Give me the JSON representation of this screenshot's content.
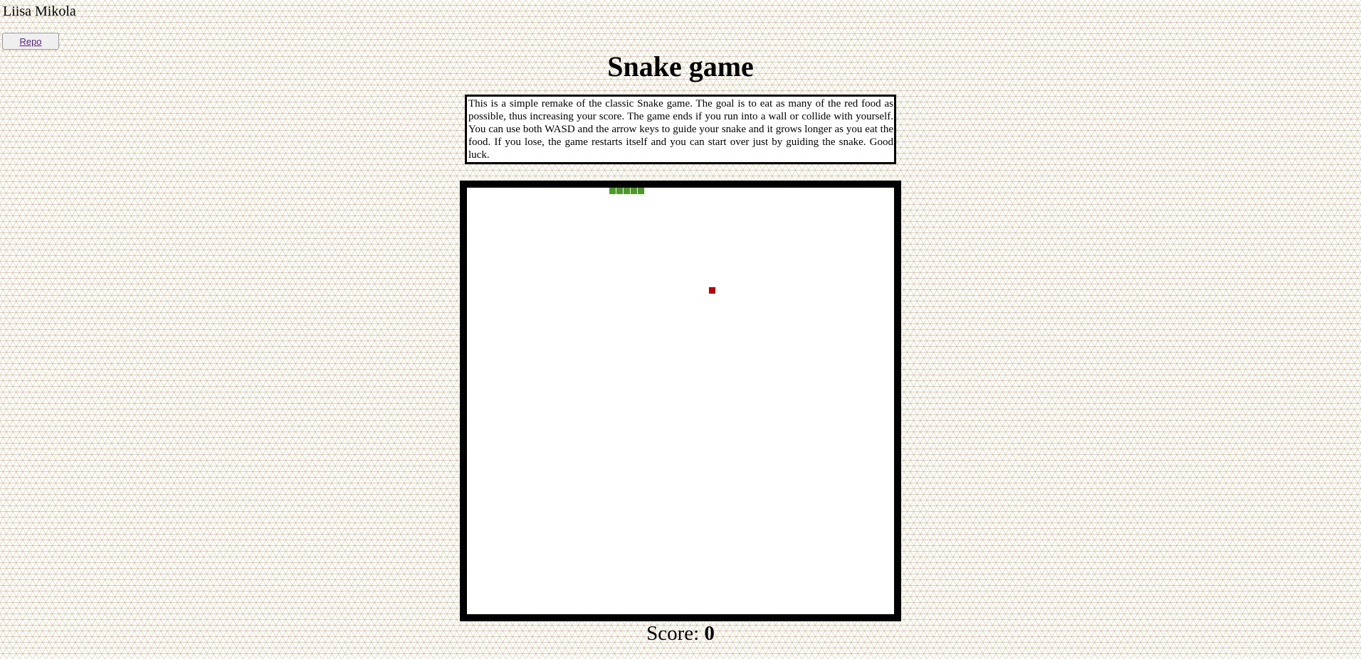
{
  "header": {
    "author": "Liisa Mikola",
    "repo_button_label": "Repo"
  },
  "game": {
    "title": "Snake game",
    "description": "This is a simple remake of the classic Snake game. The goal is to eat as many of the red food as possible, thus increasing your score. The game ends if you run into a wall or collide with yourself. You can use both WASD and the arrow keys to guide your snake and it grows longer as you eat the food. If you lose, the game restarts itself and you can start over just by guiding the snake. Good luck.",
    "score_label": "Score:",
    "score_value": "0"
  },
  "board": {
    "grid_columns": 60,
    "grid_rows": 60,
    "snake_color": "#4a9a2a",
    "food_color": "#c00000",
    "background_color": "#ffffff",
    "border_color": "#000000",
    "snake": [
      {
        "col": 20,
        "row": 0
      },
      {
        "col": 21,
        "row": 0
      },
      {
        "col": 22,
        "row": 0
      },
      {
        "col": 23,
        "row": 0
      },
      {
        "col": 24,
        "row": 0
      }
    ],
    "food": {
      "col": 34,
      "row": 14
    }
  },
  "colors": {
    "pattern_line": "#c4aa78",
    "link": "#551a8b"
  }
}
